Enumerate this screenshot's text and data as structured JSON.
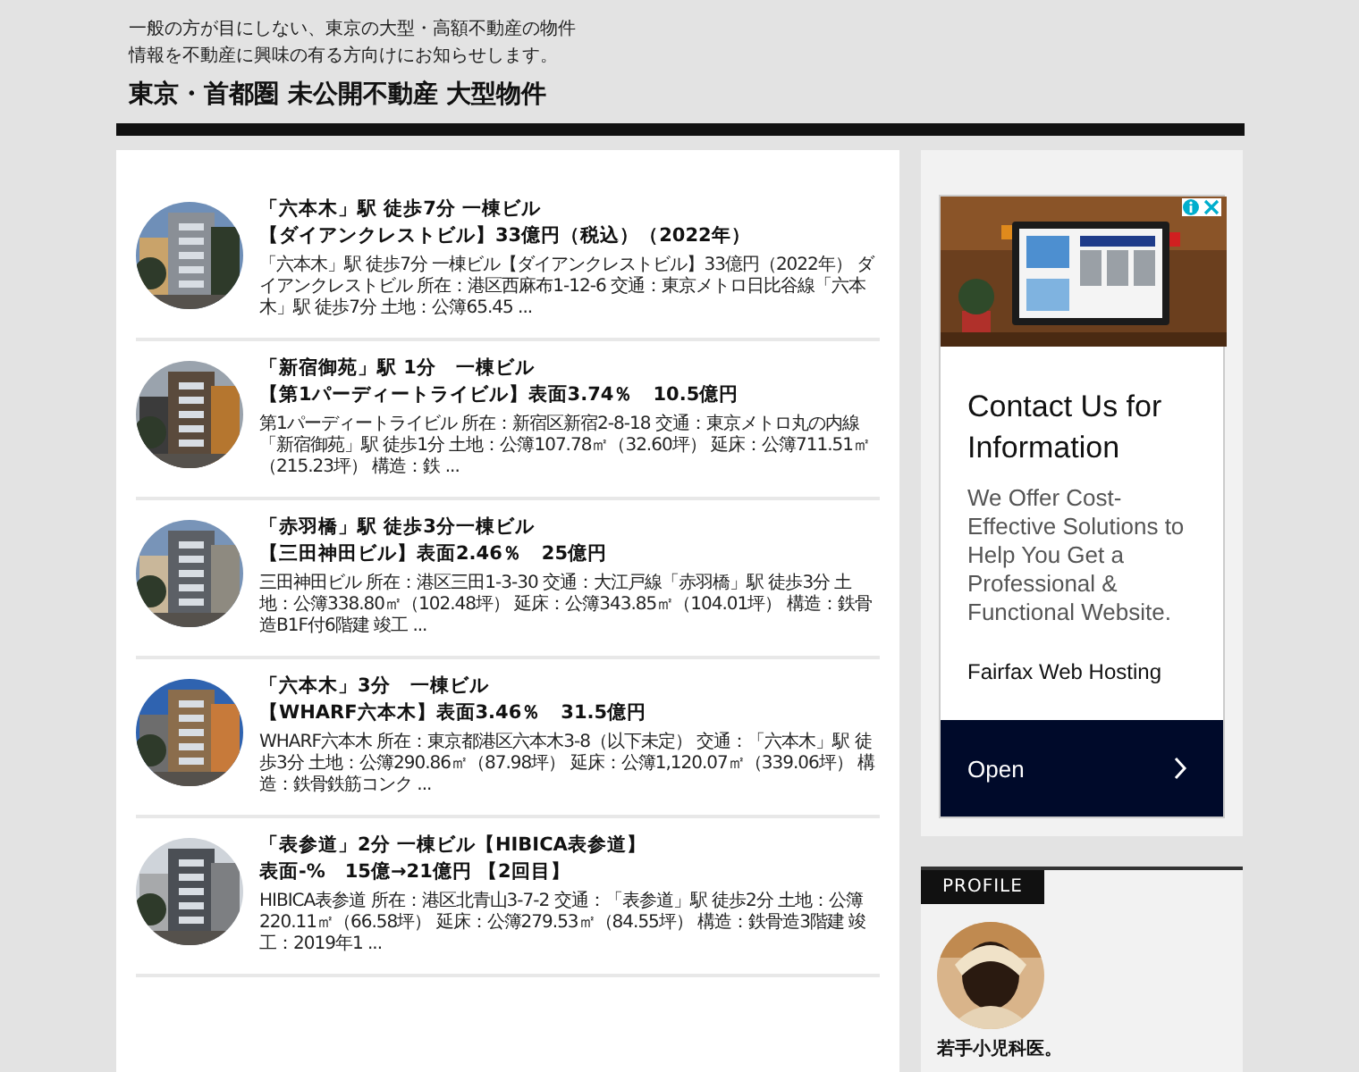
{
  "site": {
    "tagline": "一般の方が目にしない、東京の大型・高額不動産の物件情報を不動産に興味の有る方向けにお知らせします。",
    "title": "東京・首都圏 未公開不動産 大型物件"
  },
  "posts": [
    {
      "title_lines": [
        "「六本木」駅 徒歩7分 一棟ビル",
        "【ダイアンクレストビル】33億円（税込）（2022年）"
      ],
      "excerpt": "「六本木」駅 徒歩7分 一棟ビル【ダイアンクレストビル】33億円（2022年） ダイアンクレストビル 所在：港区西麻布1-12-6 交通：東京メトロ日比谷線「六本木」駅 徒歩7分 土地：公簿65.45 ..."
    },
    {
      "title_lines": [
        "「新宿御苑」駅 1分　一棟ビル",
        "【第1パーディートライビル】表面3.74％　10.5億円"
      ],
      "excerpt": "第1パーディートライビル 所在：新宿区新宿2-8-18 交通：東京メトロ丸の内線「新宿御苑」駅 徒歩1分 土地：公簿107.78㎡（32.60坪） 延床：公簿711.51㎡（215.23坪） 構造：鉄 ..."
    },
    {
      "title_lines": [
        "「赤羽橋」駅 徒歩3分一棟ビル",
        "【三田神田ビル】表面2.46％　25億円"
      ],
      "excerpt": "三田神田ビル 所在：港区三田1-3-30 交通：大江戸線「赤羽橋」駅 徒歩3分 土地：公簿338.80㎡（102.48坪） 延床：公簿343.85㎡（104.01坪） 構造：鉄骨造B1F付6階建 竣工 ..."
    },
    {
      "title_lines": [
        "「六本木」3分　一棟ビル",
        "【WHARF六本木】表面3.46％　31.5億円"
      ],
      "excerpt": "WHARF六本木 所在：東京都港区六本木3-8（以下未定） 交通：「六本木」駅 徒歩3分 土地：公簿290.86㎡（87.98坪） 延床：公簿1,120.07㎡（339.06坪） 構造：鉄骨鉄筋コンク ..."
    },
    {
      "title_lines": [
        "「表参道」2分 一棟ビル【HIBICA表参道】",
        "表面-%　15億→21億円 【2回目】"
      ],
      "excerpt": "HIBICA表参道 所在：港区北青山3-7-2 交通：「表参道」駅 徒歩2分 土地：公簿220.11㎡（66.58坪） 延床：公簿279.53㎡（84.55坪） 構造：鉄骨造3階建 竣工：2019年1 ..."
    }
  ],
  "ad": {
    "headline": "Contact Us for Information",
    "body": "We Offer Cost-Effective Solutions to Help You Get a Professional & Functional Website.",
    "advertiser": "Fairfax Web Hosting",
    "button": "Open"
  },
  "profile": {
    "heading": "PROFILE",
    "bio": "若手小児科医。"
  }
}
